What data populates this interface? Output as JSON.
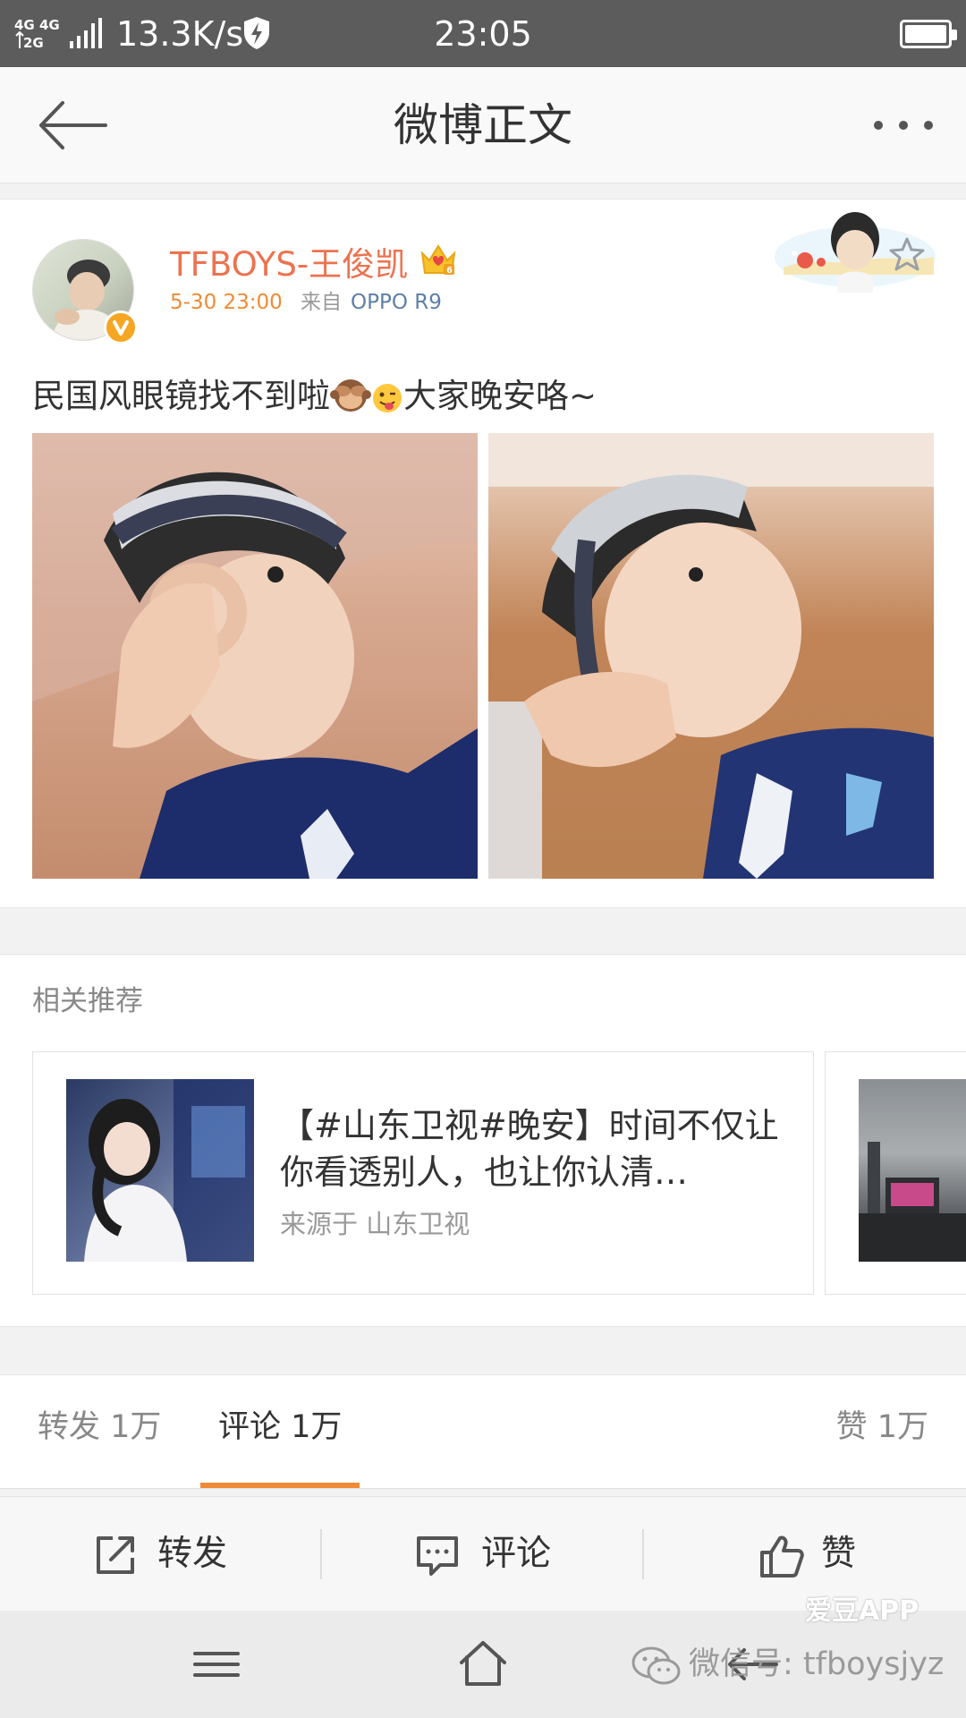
{
  "status_bar": {
    "net_top": "4G 4G",
    "net_bottom": "2G",
    "speed": "13.3K/s",
    "time": "23:05"
  },
  "nav": {
    "title": "微博正文",
    "back_icon": "arrow-left-icon",
    "more_icon": "more-dots-icon"
  },
  "post": {
    "author": "TFBOYS-王俊凯",
    "time": "5-30 23:00",
    "source_prefix": "来自",
    "source": "OPPO R9",
    "text_part1": "民国风眼镜找不到啦",
    "text_part2": "大家晚安咯~",
    "emoji": [
      "see-no-evil-monkey-icon",
      "tongue-face-icon"
    ],
    "photo_count": 2,
    "accent_name_color": "#eb7350",
    "accent_time_color": "#f08a35"
  },
  "related": {
    "heading": "相关推荐",
    "cards": [
      {
        "title": "【#山东卫视#晚安】时间不仅让你看透别人，也让你认清…",
        "source": "来源于 山东卫视"
      }
    ]
  },
  "tabs": {
    "reposts": "转发 1万",
    "comments": "评论 1万",
    "likes": "赞 1万",
    "active": "comments",
    "active_color": "#f08a35"
  },
  "actions": {
    "repost": "转发",
    "comment": "评论",
    "like": "赞"
  },
  "watermark": {
    "logo": "爱豆APP",
    "text": "微信号: tfboysjyz"
  }
}
